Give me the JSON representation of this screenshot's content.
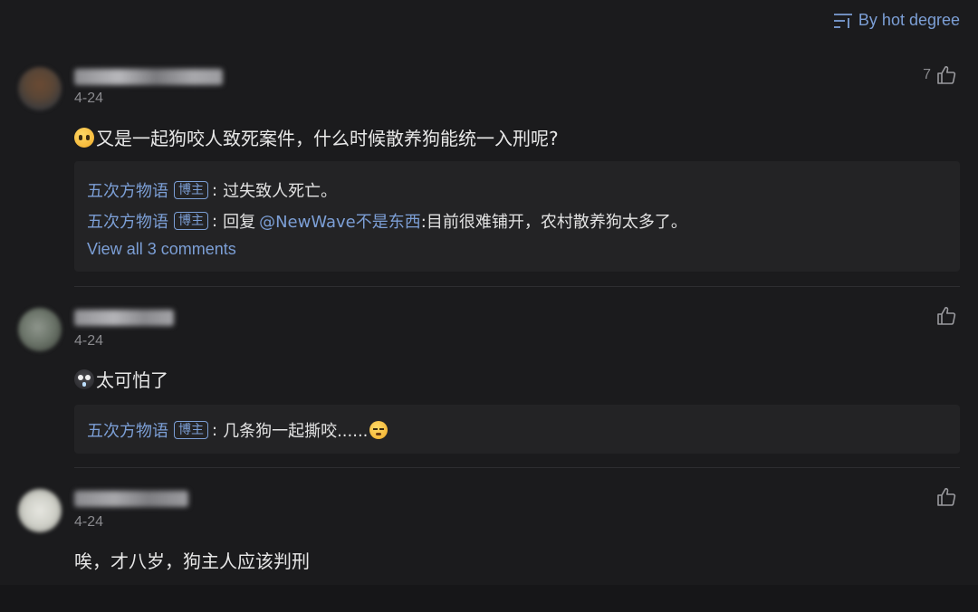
{
  "sort": {
    "icon": "sort-lines-icon",
    "label": "By hot degree",
    "color": "#7c9fd6"
  },
  "comments": [
    {
      "date": "4-24",
      "like_count": "7",
      "emoji": "pleading-face-emoji",
      "text": "又是一起狗咬人致死案件，什么时候散养狗能统一入刑呢?",
      "replies": [
        {
          "name": "五次方物语",
          "badge": "博主",
          "sep": ":",
          "text": "过失致人死亡。"
        },
        {
          "name": "五次方物语",
          "badge": "博主",
          "sep": ":",
          "prefix": "回复",
          "mention": "@NewWave不是东西",
          "text": ":目前很难铺开，农村散养狗太多了。"
        }
      ],
      "view_all": "View all 3 comments"
    },
    {
      "date": "4-24",
      "emoji": "scared-face-emoji",
      "text": "太可怕了",
      "replies": [
        {
          "name": "五次方物语",
          "badge": "博主",
          "sep": ":",
          "text": "几条狗一起撕咬......",
          "emoji": "sleepy-face-emoji"
        }
      ]
    },
    {
      "date": "4-24",
      "text": "唉，才八岁，狗主人应该判刑"
    }
  ]
}
